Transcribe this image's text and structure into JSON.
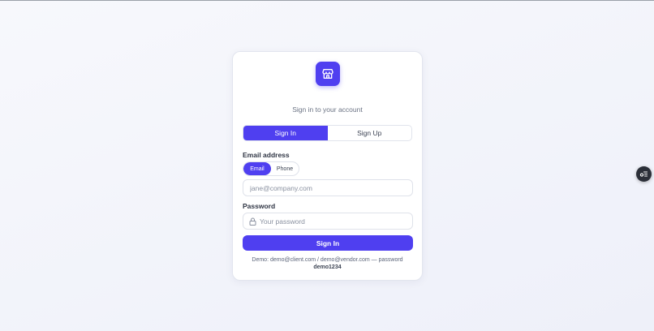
{
  "auth": {
    "subtitle": "Sign in to your account",
    "tabs": [
      {
        "label": "Sign In",
        "active": true
      },
      {
        "label": "Sign Up",
        "active": false
      }
    ],
    "email_label": "Email address",
    "method_toggle": [
      {
        "label": "Email",
        "active": true
      },
      {
        "label": "Phone",
        "active": false
      }
    ],
    "email_placeholder": "jane@company.com",
    "email_value": "",
    "password_label": "Password",
    "password_placeholder": "Your password",
    "password_value": "",
    "submit_label": "Sign In",
    "demo_text": "Demo: demo@client.com / demo@vendor.com — password",
    "demo_password": "demo1234"
  },
  "icons": {
    "logo": "storefront-icon",
    "password_field": "lock-icon",
    "floating_button": "settings-list-icon"
  },
  "colors": {
    "accent": "#4f3ff0",
    "card_background": "#ffffff",
    "page_background": "#f3f4fa",
    "text_muted": "#6a7283",
    "floating_button": "#2b2f38"
  }
}
